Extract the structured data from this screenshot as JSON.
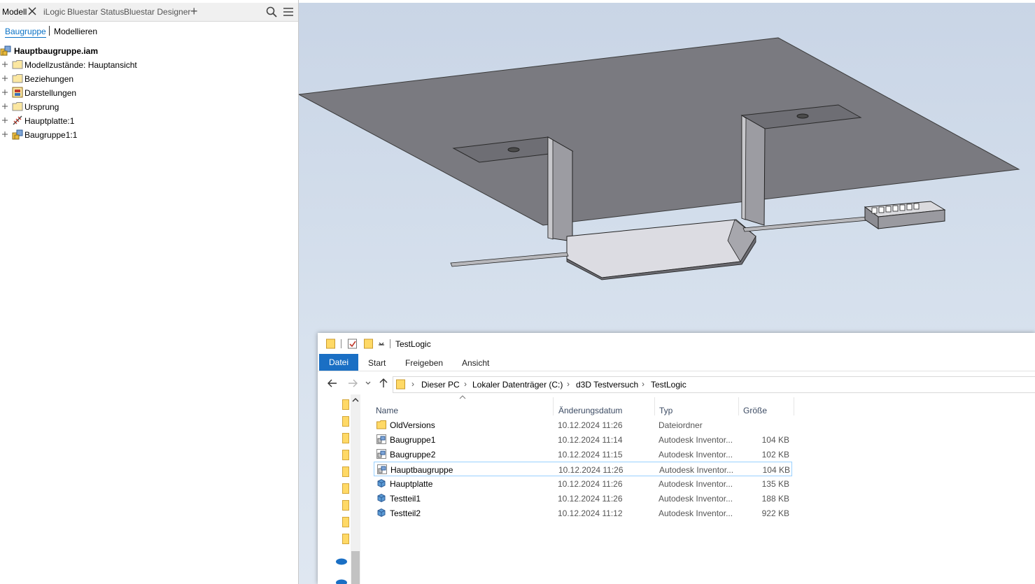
{
  "model_browser": {
    "tabs": [
      {
        "label": "Modell"
      },
      {
        "label": "iLogic"
      },
      {
        "label": "Bluestar Status"
      },
      {
        "label": "Bluestar Designer"
      }
    ],
    "subtabs": {
      "assembly": "Baugruppe",
      "modeling": "Modellieren"
    },
    "tree": [
      {
        "label": "Hauptbaugruppe.iam",
        "icon": "assembly-icon"
      },
      {
        "label": "Modellzustände: Hauptansicht",
        "icon": "folder-icon"
      },
      {
        "label": "Beziehungen",
        "icon": "folder-icon"
      },
      {
        "label": "Darstellungen",
        "icon": "representations-icon"
      },
      {
        "label": "Ursprung",
        "icon": "folder-icon"
      },
      {
        "label": "Hauptplatte:1",
        "icon": "part-icon"
      },
      {
        "label": "Baugruppe1:1",
        "icon": "assembly-icon"
      }
    ]
  },
  "explorer": {
    "title": "TestLogic",
    "ribbon": {
      "file": "Datei",
      "start": "Start",
      "share": "Freigeben",
      "view": "Ansicht"
    },
    "breadcrumbs": [
      "Dieser PC",
      "Lokaler Datenträger (C:)",
      "d3D Testversuch",
      "TestLogic"
    ],
    "columns": {
      "name": "Name",
      "date": "Änderungsdatum",
      "type": "Typ",
      "size": "Größe"
    },
    "files": [
      {
        "name": "OldVersions",
        "date": "10.12.2024 11:26",
        "type": "Dateiordner",
        "size": "",
        "icon": "folder-icon"
      },
      {
        "name": "Baugruppe1",
        "date": "10.12.2024 11:14",
        "type": "Autodesk Inventor...",
        "size": "104 KB",
        "icon": "assembly-file-icon"
      },
      {
        "name": "Baugruppe2",
        "date": "10.12.2024 11:15",
        "type": "Autodesk Inventor...",
        "size": "102 KB",
        "icon": "assembly-file-icon"
      },
      {
        "name": "Hauptbaugruppe",
        "date": "10.12.2024 11:26",
        "type": "Autodesk Inventor...",
        "size": "104 KB",
        "icon": "assembly-file-icon"
      },
      {
        "name": "Hauptplatte",
        "date": "10.12.2024 11:26",
        "type": "Autodesk Inventor...",
        "size": "135 KB",
        "icon": "part-file-icon"
      },
      {
        "name": "Testteil1",
        "date": "10.12.2024 11:26",
        "type": "Autodesk Inventor...",
        "size": "188 KB",
        "icon": "part-file-icon"
      },
      {
        "name": "Testteil2",
        "date": "10.12.2024 11:12",
        "type": "Autodesk Inventor...",
        "size": "922 KB",
        "icon": "part-file-icon"
      }
    ],
    "selected_file": "Hauptbaugruppe"
  },
  "colors": {
    "accent": "#0a72c6",
    "ribbon_file_tab": "#1a6fc4",
    "folder": "#ffd966",
    "selection_border": "#99d1ff"
  }
}
